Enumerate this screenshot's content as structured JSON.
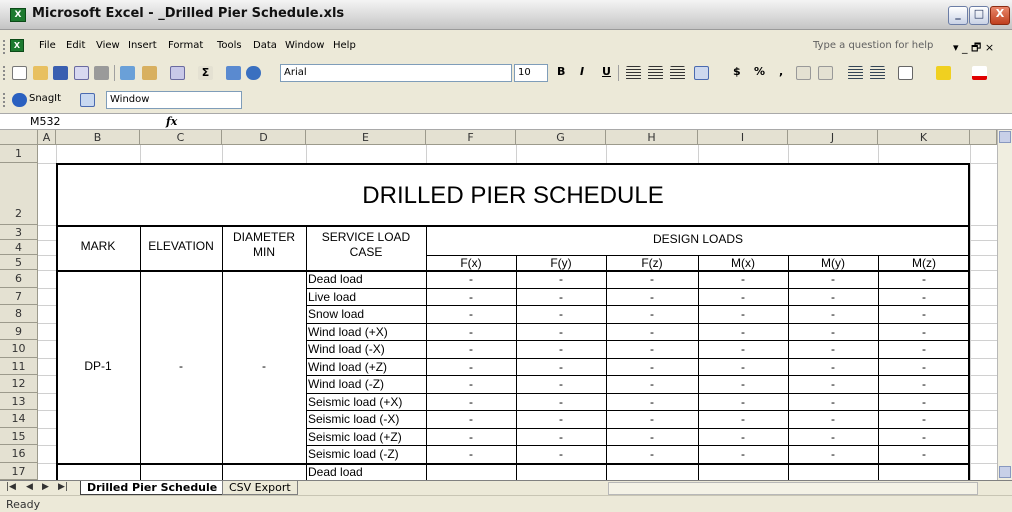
{
  "window": {
    "title": "Microsoft Excel - _Drilled Pier Schedule.xls",
    "app_icon_label": "X",
    "minimize": "_",
    "maximize": "□",
    "close": "X"
  },
  "menu": {
    "items": [
      "File",
      "Edit",
      "View",
      "Insert",
      "Format",
      "Tools",
      "Data",
      "Window",
      "Help"
    ],
    "help_placeholder": "Type a question for help",
    "mdi_controls": "▾  _  🗗  ×"
  },
  "toolbar": {
    "font_name": "Arial",
    "font_size": "10",
    "bold": "B",
    "italic": "I",
    "underline": "U",
    "currency": "$",
    "percent": "%",
    "comma": ","
  },
  "snagit_toolbar": {
    "snagit_label": "SnagIt",
    "window_value": "Window"
  },
  "formula_bar": {
    "name_box": "M532",
    "fx": "fx",
    "formula": ""
  },
  "columns": [
    "A",
    "B",
    "C",
    "D",
    "E",
    "F",
    "G",
    "H",
    "I",
    "J",
    "K"
  ],
  "rows": [
    "1",
    "2",
    "3",
    "4",
    "5",
    "6",
    "7",
    "8",
    "9",
    "10",
    "11",
    "12",
    "13",
    "14",
    "15",
    "16",
    "17"
  ],
  "schedule": {
    "title": "DRILLED PIER SCHEDULE",
    "headers": {
      "mark": "MARK",
      "elevation": "ELEVATION",
      "diameter_line1": "DIAMETER",
      "diameter_line2": "MIN",
      "service_line1": "SERVICE LOAD",
      "service_line2": "CASE",
      "design_loads": "DESIGN LOADS"
    },
    "load_columns": [
      "F(x)",
      "F(y)",
      "F(z)",
      "M(x)",
      "M(y)",
      "M(z)"
    ],
    "mark": "DP-1",
    "elevation": "-",
    "diameter": "-",
    "load_cases": [
      "Dead load",
      "Live load",
      "Snow load",
      "Wind load (+X)",
      "Wind load (-X)",
      "Wind load (+Z)",
      "Wind load (-Z)",
      "Seismic load (+X)",
      "Seismic load (-X)",
      "Seismic load (+Z)",
      "Seismic load (-Z)",
      "Dead load"
    ],
    "empty_value": "-"
  },
  "sheet_tabs": [
    {
      "label": "Drilled Pier Schedule",
      "active": true
    },
    {
      "label": "CSV Export",
      "active": false
    }
  ],
  "status": {
    "text": "Ready"
  }
}
